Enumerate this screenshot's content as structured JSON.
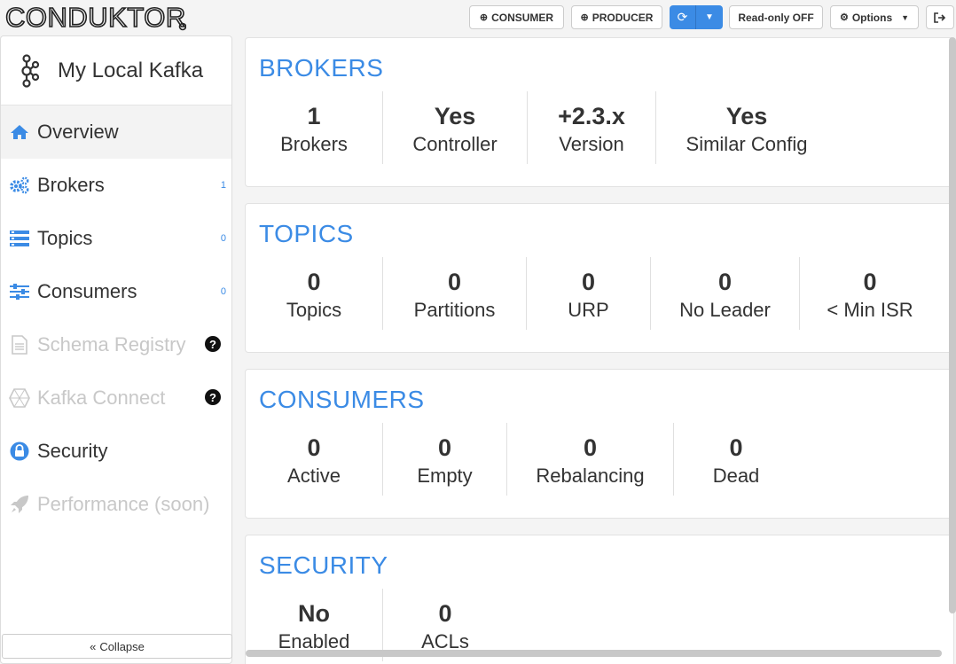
{
  "app": {
    "logo_text": "CONDUKTOR"
  },
  "toolbar": {
    "consumer_label": "CONSUMER",
    "producer_label": "PRODUCER",
    "readonly_label": "Read-only OFF",
    "options_label": "Options"
  },
  "sidebar": {
    "cluster_name": "My Local Kafka",
    "items": [
      {
        "label": "Overview",
        "icon": "home-icon",
        "active": true
      },
      {
        "label": "Brokers",
        "icon": "cogs-icon",
        "count": "1"
      },
      {
        "label": "Topics",
        "icon": "topics-icon",
        "count": "0"
      },
      {
        "label": "Consumers",
        "icon": "sliders-icon",
        "count": "0"
      },
      {
        "label": "Schema Registry",
        "icon": "file-icon",
        "disabled": true
      },
      {
        "label": "Kafka Connect",
        "icon": "connect-icon",
        "disabled": true
      },
      {
        "label": "Security",
        "icon": "lock-icon"
      },
      {
        "label": "Performance (soon)",
        "icon": "rocket-icon",
        "disabled": true
      }
    ],
    "collapse_label": "Collapse"
  },
  "cards": {
    "brokers": {
      "title": "BROKERS",
      "stats": [
        {
          "value": "1",
          "label": "Brokers"
        },
        {
          "value": "Yes",
          "label": "Controller"
        },
        {
          "value": "+2.3.x",
          "label": "Version"
        },
        {
          "value": "Yes",
          "label": "Similar Config"
        }
      ]
    },
    "topics": {
      "title": "TOPICS",
      "stats": [
        {
          "value": "0",
          "label": "Topics"
        },
        {
          "value": "0",
          "label": "Partitions"
        },
        {
          "value": "0",
          "label": "URP"
        },
        {
          "value": "0",
          "label": "No Leader"
        },
        {
          "value": "0",
          "label": "< Min ISR"
        }
      ]
    },
    "consumers": {
      "title": "CONSUMERS",
      "stats": [
        {
          "value": "0",
          "label": "Active"
        },
        {
          "value": "0",
          "label": "Empty"
        },
        {
          "value": "0",
          "label": "Rebalancing"
        },
        {
          "value": "0",
          "label": "Dead"
        }
      ]
    },
    "security": {
      "title": "SECURITY",
      "stats": [
        {
          "value": "No",
          "label": "Enabled"
        },
        {
          "value": "0",
          "label": "ACLs"
        }
      ]
    }
  },
  "colors": {
    "accent": "#3b8be5",
    "disabled": "#c8c8c8"
  }
}
